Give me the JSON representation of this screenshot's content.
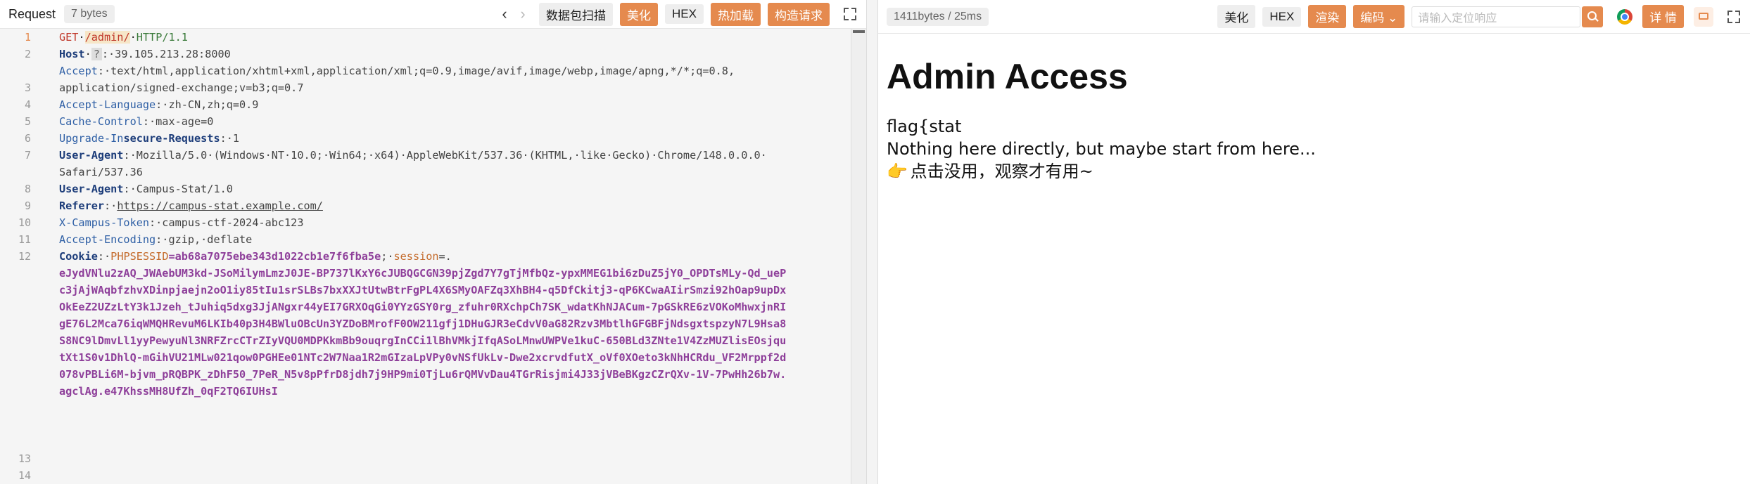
{
  "request": {
    "title": "Request",
    "size": "7 bytes",
    "nav_back": "‹",
    "nav_fwd": "›",
    "btn_scan": "数据包扫描",
    "btn_beautify": "美化",
    "btn_hex": "HEX",
    "btn_hotload": "热加载",
    "btn_build": "构造请求"
  },
  "code": {
    "line_numbers": [
      "1",
      "2",
      "",
      "3",
      "4",
      "5",
      "6",
      "7",
      "",
      "8",
      "9",
      "10",
      "11",
      "12",
      "",
      "",
      "",
      "",
      "",
      "",
      "",
      "",
      "",
      "",
      "",
      "13",
      "14"
    ],
    "l1": {
      "method": "GET",
      "path": "/admin/",
      "version": "HTTP/1.1"
    },
    "l2": {
      "key": "Host",
      "q": "?",
      "value": ":·39.105.213.28:8000"
    },
    "l3a": {
      "key": "Accept",
      "value": ":·text/html,application/xhtml+xml,application/xml;q=0.9,image/avif,image/webp,image/apng,*/*;q=0.8,"
    },
    "l3b": "application/signed-exchange;v=b3;q=0.7",
    "l4": {
      "key": "Accept-Language",
      "value": ":·zh-CN,zh;q=0.9"
    },
    "l5": {
      "key": "Cache-Control",
      "value": ":·max-age=0"
    },
    "l6": {
      "key": "Upgrade-In",
      "key_bold": "secure-Requests",
      "value": ":·1"
    },
    "l7a": {
      "key": "User-Agent",
      "value": ":·Mozilla/5.0·(Windows·NT·10.0;·Win64;·x64)·AppleWebKit/537.36·(KHTML,·like·Gecko)·Chrome/148.0.0.0·"
    },
    "l7b": "Safari/537.36",
    "l8": {
      "key": "User-Agent",
      "value": ":·Campus-Stat/1.0"
    },
    "l9": {
      "key": "Referer",
      "sep": ":·",
      "value": "https://campus-stat.example.com/"
    },
    "l10": {
      "key": "X-Campus-Token",
      "value": ":·campus-ctf-2024-abc123"
    },
    "l11": {
      "key": "Accept-Encoding",
      "value": ":·gzip,·deflate"
    },
    "l12": {
      "key": "Cookie",
      "sep": ":·",
      "c1k": "PHPSESSID",
      "c1v": "=ab68a7075ebe343d1022cb1e7f6fba5e",
      "semi": ";·",
      "c2k": "session",
      "c2v": "=."
    },
    "cookie_lines": [
      "eJydVNlu2zAQ_JWAebUM3kd-JSoMilymLmzJ0JE-BP737lKxY6cJUBQGCGN39pjZgd7Y7gTjMfbQz-ypxMMEG1bi6zDuZ5jY0_OPDTsMLy-Qd_ueP",
      "c3jAjWAqbfzhvXDinpjaejn2oO1iy85tIu1srSLBs7bxXXJtUtwBtrFgPL4X6SMyOAFZq3XhBH4-q5DfCkitj3-qP6KCwaAIirSmzi92hOap9upDx",
      "OkEeZ2UZzLtY3k1Jzeh_tJuhiq5dxg3JjANgxr44yEI7GRXOqGi0YYzGSY0rg_zfuhr0RXchpCh7SK_wdatKhNJACum-7pGSkRE6zVOKoMhwxjnRI",
      "gE76L2Mca76iqWMQHRevuM6LKIb40p3H4BWluOBcUn3YZDoBMrofF0OW211gfj1DHuGJR3eCdvV0aG82Rzv3MbtlhGFGBFjNdsgxtspzyN7L9Hsa8",
      "S8NC9lDmvLl1yyPewyuNl3NRFZrcCTrZIyVQU0MDPKkmBb9ouqrgInCCi1lBhVMkjIfqASoLMnwUWPVe1kuC-650BLd3ZNte1V4ZzMUZlisEOsjqu",
      "tXt1S0v1DhlQ-mGihVU21MLw021qow0PGHEe01NTc2W7Naa1R2mGIzaLpVPy0vNSfUkLv-Dwe2xcrvdfutX_oVf0XOeto3kNhHCRdu_VF2Mrppf2d",
      "078vPBLi6M-bjvm_pRQBPK_zDhF50_7PeR_N5v8pPfrD8jdh7j9HP9mi0TjLu6rQMVvDau4TGrRisjmi4J33jVBeBKgzCZrQXv-1V-7PwHh26b7w.",
      "agclAg.e47KhssMH8UfZh_0qF2TQ6IUHsI"
    ]
  },
  "response": {
    "stats": "1411bytes / 25ms",
    "btn_beautify": "美化",
    "btn_hex": "HEX",
    "btn_render": "渲染",
    "btn_encode": "编码 ⌄",
    "search_placeholder": "请输入定位响应",
    "btn_detail": "详 情"
  },
  "render": {
    "heading": "Admin Access",
    "line1": "flag{stat",
    "line2": "Nothing here directly, but maybe start from here...",
    "line3_emoji": "👉",
    "line3": "点击没用，观察才有用~"
  },
  "colors": {
    "accent": "#e58a4e",
    "editor_bg": "#f5f5f5",
    "header_key": "#2e5fa5",
    "cookie_value": "#8e3f9a"
  }
}
